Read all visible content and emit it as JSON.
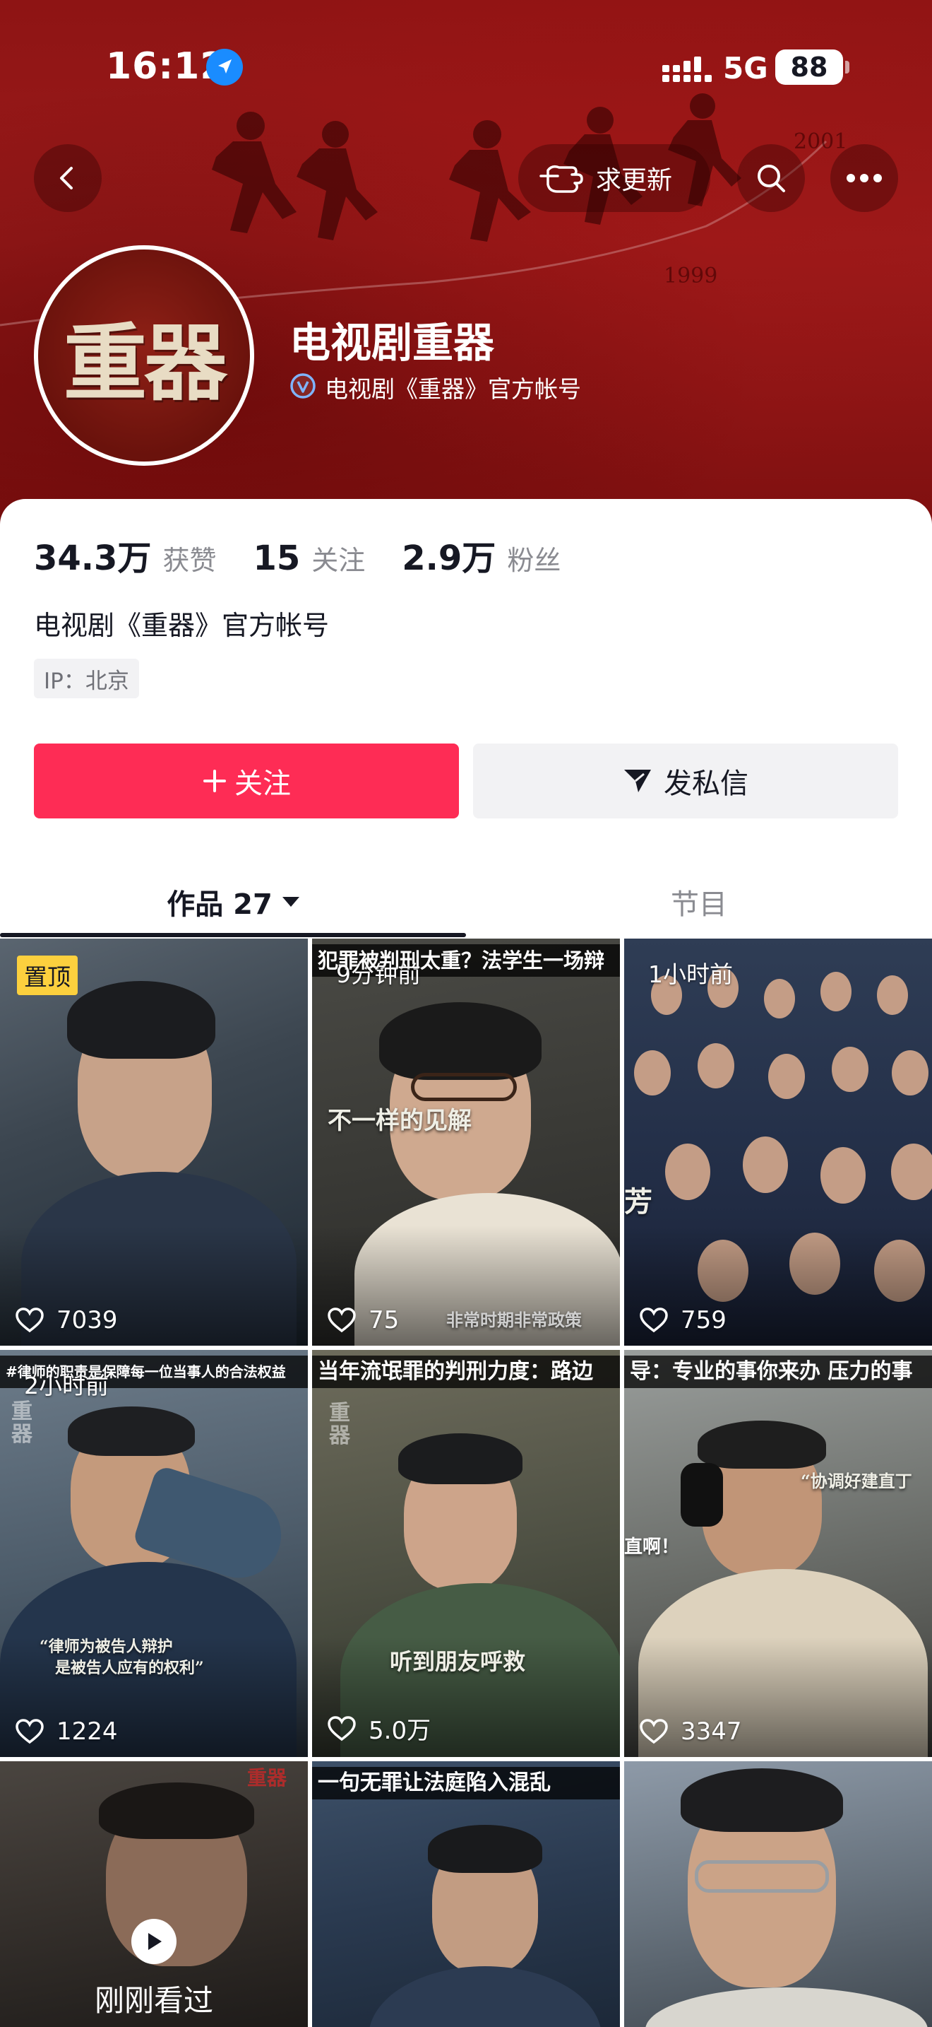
{
  "status_bar": {
    "time": "16:12",
    "network": "5G",
    "battery": "88"
  },
  "header": {
    "update_label": "求更新",
    "year_top": "2001",
    "year_bottom": "1999"
  },
  "profile": {
    "avatar_text": "重器",
    "name": "电视剧重器",
    "verification": "电视剧《重器》官方帐号",
    "stats": {
      "likes_value": "34.3万",
      "likes_label": "获赞",
      "following_value": "15",
      "following_label": "关注",
      "followers_value": "2.9万",
      "followers_label": "粉丝"
    },
    "bio": "电视剧《重器》官方帐号",
    "ip": "IP：北京",
    "follow_label": "关注",
    "message_label": "发私信"
  },
  "tabs": {
    "works_label": "作品 27",
    "shows_label": "节目"
  },
  "videos": [
    {
      "badge": "置顶",
      "likes": "7039"
    },
    {
      "top_text": "犯罪被判刑太重？法学生一场辩",
      "time": "9分钟前",
      "caption": "不一样的见解",
      "caption2": "非常时期非常政策",
      "likes": "75"
    },
    {
      "time": "1小时前",
      "caption": "芳",
      "likes": "759"
    },
    {
      "top_text": "#律师的职责是保障每一位当事人的合法权益",
      "time": "2小时前",
      "watermark": "重器",
      "caption": "“律师为被告人辩护",
      "caption2": "是被告人应有的权利”",
      "likes": "1224"
    },
    {
      "top_text": "当年流氓罪的判刑力度：路边",
      "watermark": "重器",
      "caption": "听到朋友呼救",
      "likes": "5.0万"
    },
    {
      "top_text": "导：专业的事你来办 压力的事",
      "caption": "“协调好建直丁",
      "caption2": "直啊！",
      "likes": "3347"
    },
    {
      "watermark": "重器",
      "viewed": "刚刚看过"
    },
    {
      "top_text": "一句无罪让法庭陷入混乱"
    },
    {}
  ],
  "colors": {
    "primary": "#fe2c55",
    "pin": "#fcd03e",
    "header_red": "#9c1b1b"
  }
}
